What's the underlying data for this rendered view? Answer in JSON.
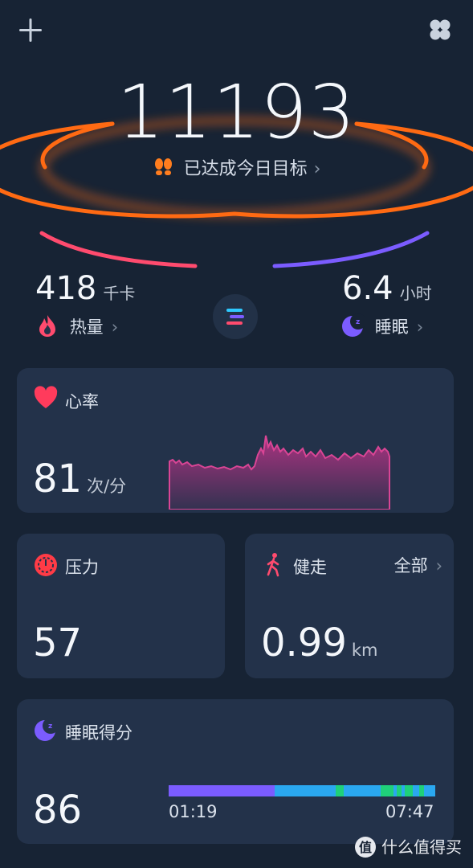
{
  "header": {
    "add_icon": "plus-icon",
    "menu_icon": "grid-four-circles-icon"
  },
  "steps": {
    "value": "11193",
    "goal_text": "已达成今日目标",
    "icon": "footprints-icon",
    "chevron": "›",
    "accent": "#ff6a13"
  },
  "calories": {
    "value": "418",
    "unit": "千卡",
    "label": "热量",
    "icon": "flame-icon",
    "chevron": "›",
    "color": "#ff4b6e"
  },
  "sleep_summary": {
    "value": "6.4",
    "unit": "小时",
    "label": "睡眠",
    "icon": "moon-sleep-icon",
    "chevron": "›",
    "color": "#7b5cff"
  },
  "center_button": {
    "icon": "list-lines-icon"
  },
  "heart_rate": {
    "title": "心率",
    "value": "81",
    "unit": "次/分",
    "icon": "heart-icon",
    "color": "#ff3b5c"
  },
  "stress": {
    "title": "压力",
    "value": "57",
    "icon": "stopwatch-icon",
    "color": "#ff3b46"
  },
  "walking": {
    "title": "健走",
    "filter": "全部",
    "chevron": "›",
    "value": "0.99",
    "unit": "km",
    "icon": "walking-person-icon",
    "color": "#ff4b6e"
  },
  "sleep_score": {
    "title": "睡眠得分",
    "value": "86",
    "start_time": "01:19",
    "end_time": "07:47",
    "icon": "moon-sleep-icon",
    "color": "#7b5cff"
  },
  "watermark": {
    "icon": "value-logo-icon",
    "text": "什么值得买"
  }
}
